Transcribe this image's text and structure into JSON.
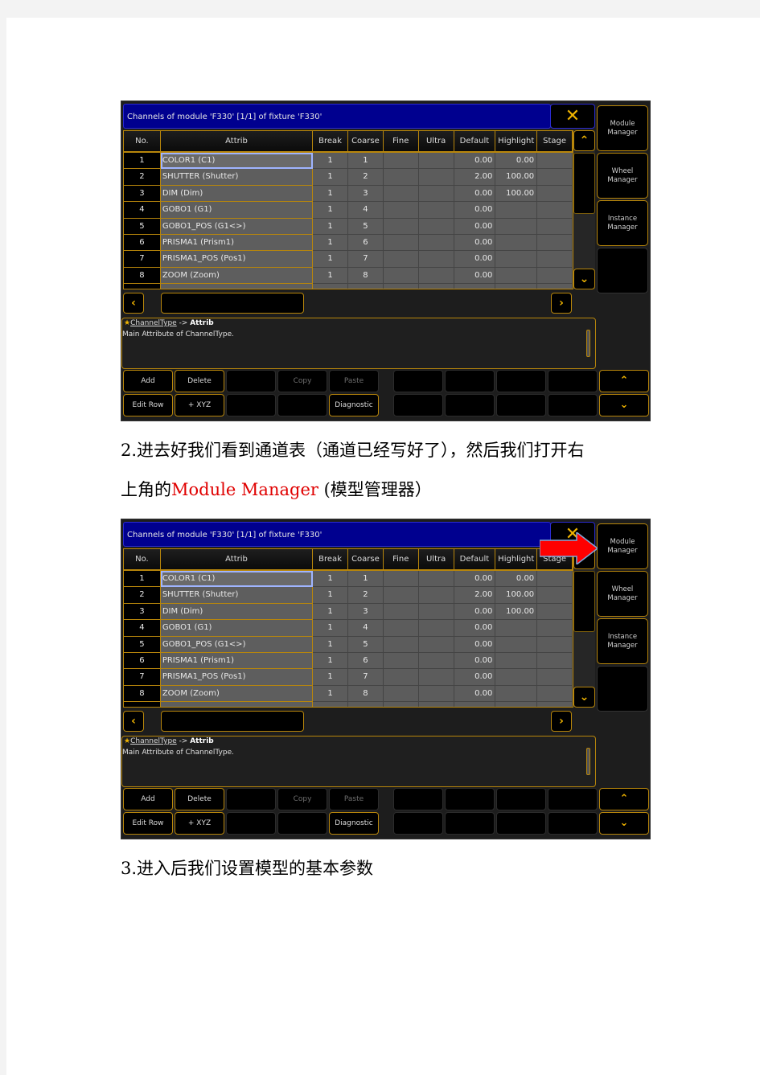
{
  "screenshots": [
    {
      "title": "Channels of module 'F330' [1/1] of fixture 'F330'",
      "close_icon": "✕",
      "columns": [
        "No.",
        "Attrib",
        "Break",
        "Coarse",
        "Fine",
        "Ultra",
        "Default",
        "Highlight",
        "Stage"
      ],
      "rows": [
        {
          "no": "1",
          "attrib": "COLOR1 (C1)",
          "break": "1",
          "coarse": "1",
          "fine": "",
          "ultra": "",
          "default": "0.00",
          "highlight": "0.00",
          "stage": ""
        },
        {
          "no": "2",
          "attrib": "SHUTTER (Shutter)",
          "break": "1",
          "coarse": "2",
          "fine": "",
          "ultra": "",
          "default": "2.00",
          "highlight": "100.00",
          "stage": ""
        },
        {
          "no": "3",
          "attrib": "DIM (Dim)",
          "break": "1",
          "coarse": "3",
          "fine": "",
          "ultra": "",
          "default": "0.00",
          "highlight": "100.00",
          "stage": ""
        },
        {
          "no": "4",
          "attrib": "GOBO1 (G1)",
          "break": "1",
          "coarse": "4",
          "fine": "",
          "ultra": "",
          "default": "0.00",
          "highlight": "",
          "stage": ""
        },
        {
          "no": "5",
          "attrib": "GOBO1_POS (G1<>)",
          "break": "1",
          "coarse": "5",
          "fine": "",
          "ultra": "",
          "default": "0.00",
          "highlight": "",
          "stage": ""
        },
        {
          "no": "6",
          "attrib": "PRISMA1 (Prism1)",
          "break": "1",
          "coarse": "6",
          "fine": "",
          "ultra": "",
          "default": "0.00",
          "highlight": "",
          "stage": ""
        },
        {
          "no": "7",
          "attrib": "PRISMA1_POS (Pos1)",
          "break": "1",
          "coarse": "7",
          "fine": "",
          "ultra": "",
          "default": "0.00",
          "highlight": "",
          "stage": ""
        },
        {
          "no": "8",
          "attrib": "ZOOM (Zoom)",
          "break": "1",
          "coarse": "8",
          "fine": "",
          "ultra": "",
          "default": "0.00",
          "highlight": "",
          "stage": ""
        }
      ],
      "side_buttons": [
        "Module\nManager",
        "Wheel\nManager",
        "Instance\nManager",
        ""
      ],
      "info": {
        "star_icon": "★",
        "link": "ChannelType",
        "arrow": " -> ",
        "target": "Attrib",
        "description": "Main Attribute of ChannelType."
      },
      "buttons_row1": [
        "Add",
        "Delete",
        "",
        "Copy",
        "Paste",
        "",
        "",
        "",
        ""
      ],
      "buttons_row2": [
        "Edit Row",
        "+ XYZ",
        "",
        "",
        "Diagnostic",
        "",
        "",
        "",
        ""
      ],
      "scroll_icons": {
        "up": "⌃",
        "down": "⌄",
        "left": "‹",
        "right": "›"
      },
      "annotation_arrow": false
    },
    {
      "title": "Channels of module 'F330' [1/1] of fixture 'F330'",
      "close_icon": "✕",
      "columns": [
        "No.",
        "Attrib",
        "Break",
        "Coarse",
        "Fine",
        "Ultra",
        "Default",
        "Highlight",
        "Stage"
      ],
      "rows": [
        {
          "no": "1",
          "attrib": "COLOR1 (C1)",
          "break": "1",
          "coarse": "1",
          "fine": "",
          "ultra": "",
          "default": "0.00",
          "highlight": "0.00",
          "stage": ""
        },
        {
          "no": "2",
          "attrib": "SHUTTER (Shutter)",
          "break": "1",
          "coarse": "2",
          "fine": "",
          "ultra": "",
          "default": "2.00",
          "highlight": "100.00",
          "stage": ""
        },
        {
          "no": "3",
          "attrib": "DIM (Dim)",
          "break": "1",
          "coarse": "3",
          "fine": "",
          "ultra": "",
          "default": "0.00",
          "highlight": "100.00",
          "stage": ""
        },
        {
          "no": "4",
          "attrib": "GOBO1 (G1)",
          "break": "1",
          "coarse": "4",
          "fine": "",
          "ultra": "",
          "default": "0.00",
          "highlight": "",
          "stage": ""
        },
        {
          "no": "5",
          "attrib": "GOBO1_POS (G1<>)",
          "break": "1",
          "coarse": "5",
          "fine": "",
          "ultra": "",
          "default": "0.00",
          "highlight": "",
          "stage": ""
        },
        {
          "no": "6",
          "attrib": "PRISMA1 (Prism1)",
          "break": "1",
          "coarse": "6",
          "fine": "",
          "ultra": "",
          "default": "0.00",
          "highlight": "",
          "stage": ""
        },
        {
          "no": "7",
          "attrib": "PRISMA1_POS (Pos1)",
          "break": "1",
          "coarse": "7",
          "fine": "",
          "ultra": "",
          "default": "0.00",
          "highlight": "",
          "stage": ""
        },
        {
          "no": "8",
          "attrib": "ZOOM (Zoom)",
          "break": "1",
          "coarse": "8",
          "fine": "",
          "ultra": "",
          "default": "0.00",
          "highlight": "",
          "stage": ""
        }
      ],
      "side_buttons": [
        "Module\nManager",
        "Wheel\nManager",
        "Instance\nManager",
        ""
      ],
      "info": {
        "star_icon": "★",
        "link": "ChannelType",
        "arrow": " -> ",
        "target": "Attrib",
        "description": "Main Attribute of ChannelType."
      },
      "buttons_row1": [
        "Add",
        "Delete",
        "",
        "Copy",
        "Paste",
        "",
        "",
        "",
        ""
      ],
      "buttons_row2": [
        "Edit Row",
        "+ XYZ",
        "",
        "",
        "Diagnostic",
        "",
        "",
        "",
        ""
      ],
      "scroll_icons": {
        "up": "⌃",
        "down": "⌄",
        "left": "‹",
        "right": "›"
      },
      "annotation_arrow": true
    }
  ],
  "text": {
    "step2_line1": "2.进去好我们看到通道表（通道已经写好了），然后我们打开右",
    "step2_line2_pre": "上角的",
    "step2_line2_red": "Module  Manager",
    "step2_line2_post": " (模型管理器）",
    "step3": "3.进入后我们设置模型的基本参数"
  },
  "colors": {
    "accent": "#f0b400",
    "border": "#b8860b",
    "title_bg": "#00008f",
    "highlight_text": "#e00000",
    "annotation_arrow": "#ff0000"
  }
}
